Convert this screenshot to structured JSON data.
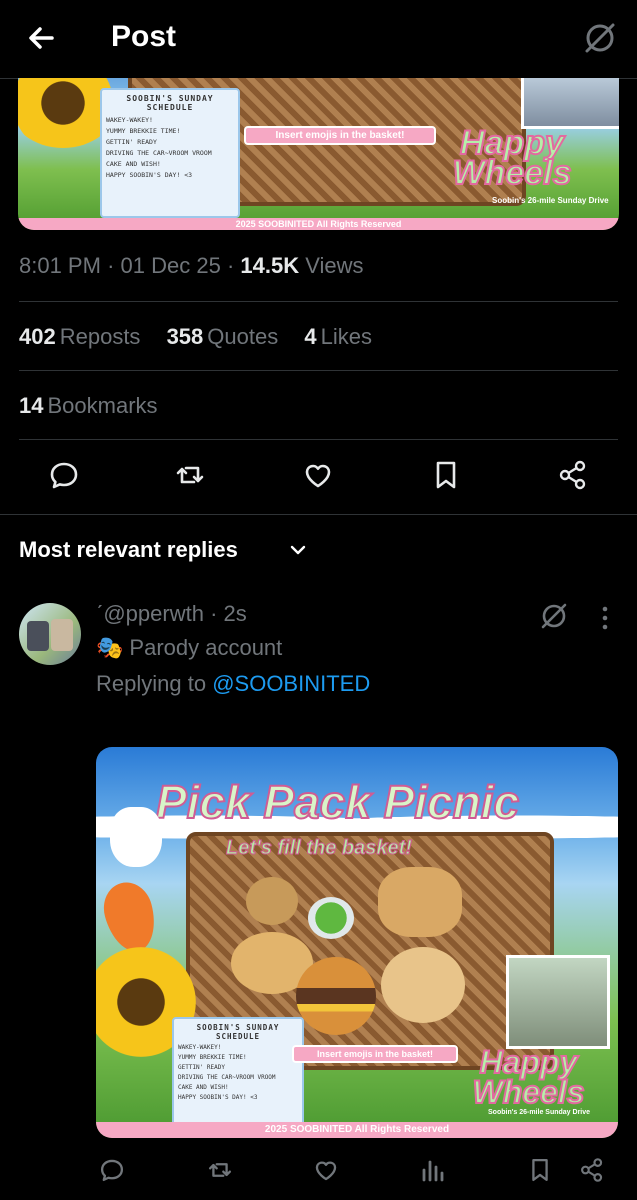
{
  "header": {
    "title": "Post"
  },
  "media1": {
    "schedule_title": "SOOBIN'S SUNDAY SCHEDULE",
    "schedule_items": [
      "WAKEY-WAKEY!",
      "YUMMY BREKKIE TIME!",
      "GETTIN' READY",
      "DRIVING THE CAR~VROOM VROOM",
      "CAKE AND WISH!",
      "HAPPY SOOBIN'S DAY! <3"
    ],
    "insert_label": "Insert emojis in the basket!",
    "happy_wheels": "Happy Wheels",
    "subtitle": "Soobin's 26-mile Sunday Drive",
    "copyright": "2025 SOOBINITED All Rights Reserved"
  },
  "post_meta": {
    "time": "8:01 PM",
    "date": "01 Dec 25",
    "views_count": "14.5K",
    "views_label": "Views"
  },
  "stats": {
    "reposts_count": "402",
    "reposts_label": "Reposts",
    "quotes_count": "358",
    "quotes_label": "Quotes",
    "likes_count": "4",
    "likes_label": "Likes",
    "bookmarks_count": "14",
    "bookmarks_label": "Bookmarks"
  },
  "replies_header": "Most relevant replies",
  "reply": {
    "handle": "@pperwth",
    "handle_prefix": "ˊ",
    "time": "2s",
    "parody_label": "Parody account",
    "replying_to_label": "Replying to",
    "replying_to_handle": "@SOOBINITED",
    "media": {
      "title": "Pick Pack Picnic",
      "subtitle": "Let's fill the basket!",
      "schedule_title": "SOOBIN'S SUNDAY SCHEDULE",
      "schedule_items": [
        "WAKEY-WAKEY!",
        "YUMMY BREKKIE TIME!",
        "GETTIN' READY",
        "DRIVING THE CAR~VROOM VROOM",
        "CAKE AND WISH!",
        "HAPPY SOOBIN'S DAY! <3"
      ],
      "insert_label": "Insert emojis in the basket!",
      "happy_wheels": "Happy Wheels",
      "subtitle2": "Soobin's 26-mile Sunday Drive",
      "copyright": "2025 SOOBINITED All Rights Reserved"
    }
  },
  "colors": {
    "background": "#000000",
    "text": "#e7e9ea",
    "muted": "#71767b",
    "link": "#1d9bf0",
    "divider": "#2f3336"
  },
  "icons": [
    "back-arrow-icon",
    "grok-icon",
    "reply-icon",
    "repost-icon",
    "like-icon",
    "bookmark-icon",
    "share-icon",
    "chevron-down-icon",
    "more-icon",
    "views-icon"
  ]
}
